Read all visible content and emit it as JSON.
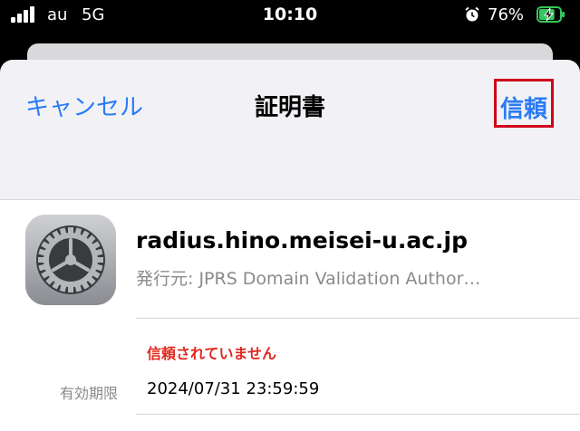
{
  "status_bar": {
    "carrier": "au",
    "network": "5G",
    "time": "10:10",
    "battery_percent": "76%",
    "battery_level": 0.76,
    "signal_bars": 4
  },
  "nav": {
    "cancel": "キャンセル",
    "title": "証明書",
    "trust": "信頼"
  },
  "certificate": {
    "name": "radius.hino.meisei-u.ac.jp",
    "issuer": "発行元: JPRS Domain Validation Author…",
    "status": "信頼されていません",
    "expires_label": "有効期限",
    "expires_value": "2024/07/31 23:59:59",
    "icon": "gear-settings-icon"
  },
  "colors": {
    "accent": "#2a7bf6",
    "warning": "#e0281f",
    "highlight_box": "#d0021b",
    "battery_charging": "#34c759"
  }
}
